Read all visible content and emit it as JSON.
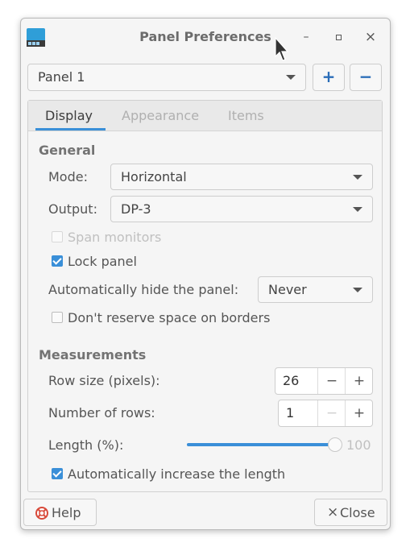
{
  "window": {
    "title": "Panel Preferences"
  },
  "titlebar": {
    "minimize": "–",
    "maximize": "▫",
    "close": "×"
  },
  "panel_selector": {
    "selected": "Panel 1",
    "add_label": "+",
    "remove_label": "−"
  },
  "tabs": [
    {
      "label": "Display",
      "active": true
    },
    {
      "label": "Appearance",
      "active": false
    },
    {
      "label": "Items",
      "active": false
    }
  ],
  "general": {
    "heading": "General",
    "mode_label": "Mode:",
    "mode_value": "Horizontal",
    "output_label": "Output:",
    "output_value": "DP-3",
    "span_monitors": {
      "label": "Span monitors",
      "checked": false,
      "enabled": false
    },
    "lock_panel": {
      "label": "Lock panel",
      "checked": true
    },
    "autohide_label": "Automatically hide the panel:",
    "autohide_value": "Never",
    "dont_reserve": {
      "label": "Don't reserve space on borders",
      "checked": false
    }
  },
  "measurements": {
    "heading": "Measurements",
    "row_size_label": "Row size (pixels):",
    "row_size_value": "26",
    "rows_label": "Number of rows:",
    "rows_value": "1",
    "length_label": "Length (%):",
    "length_value": "100",
    "length_fraction": 1.0,
    "auto_increase": {
      "label": "Automatically increase the length",
      "checked": true
    }
  },
  "spin_buttons": {
    "minus": "−",
    "plus": "+"
  },
  "footer": {
    "help_label": "Help",
    "close_label": "Close",
    "close_glyph": "×"
  },
  "colors": {
    "accent": "#3a8fd8",
    "help_icon": "#d84a3a"
  }
}
